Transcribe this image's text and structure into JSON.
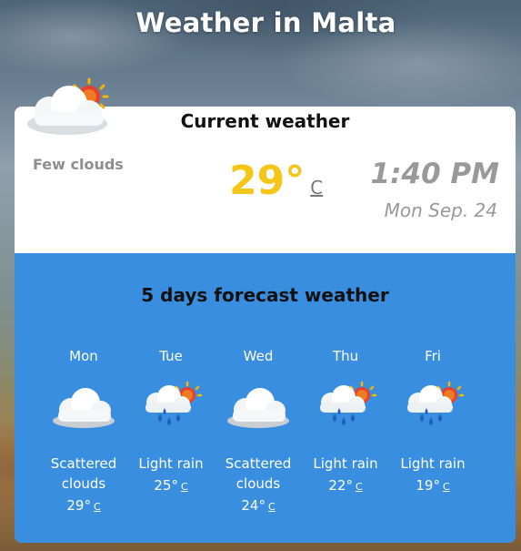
{
  "title": "Weather in Malta",
  "current": {
    "heading": "Current weather",
    "condition": "Few clouds",
    "temperature": "29°",
    "unit": "C",
    "time": "1:40 PM",
    "date": "Mon Sep. 24",
    "icon": "few-clouds-icon"
  },
  "forecast": {
    "heading": "5 days forecast weather",
    "days": [
      {
        "name": "Mon",
        "icon": "scattered-clouds-icon",
        "description": "Scattered clouds",
        "temp": "29°",
        "unit": "C"
      },
      {
        "name": "Tue",
        "icon": "light-rain-icon",
        "description": "Light rain",
        "temp": "25°",
        "unit": "C"
      },
      {
        "name": "Wed",
        "icon": "scattered-clouds-icon",
        "description": "Scattered clouds",
        "temp": "24°",
        "unit": "C"
      },
      {
        "name": "Thu",
        "icon": "light-rain-icon",
        "description": "Light rain",
        "temp": "22°",
        "unit": "C"
      },
      {
        "name": "Fri",
        "icon": "light-rain-icon",
        "description": "Light rain",
        "temp": "19°",
        "unit": "C"
      }
    ]
  },
  "colors": {
    "forecast_bg": "#3a8ee0",
    "temperature": "#f5c518",
    "muted_text": "#999999"
  }
}
